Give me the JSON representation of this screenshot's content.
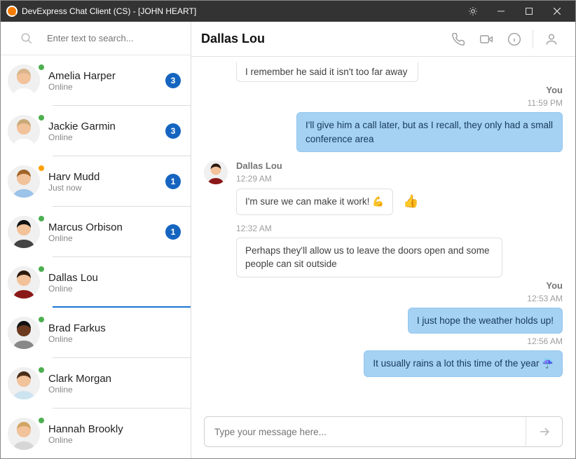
{
  "window": {
    "title": "DevExpress Chat Client (CS) - [JOHN HEART]"
  },
  "search": {
    "placeholder": "Enter text to search..."
  },
  "contacts": [
    {
      "name": "Amelia Harper",
      "sub": "Online",
      "status": "online",
      "badge": "3",
      "hair": "#d9b58a",
      "shirt": "#fff"
    },
    {
      "name": "Jackie Garmin",
      "sub": "Online",
      "status": "online",
      "badge": "3",
      "hair": "#c9a977",
      "shirt": "#fff"
    },
    {
      "name": "Harv Mudd",
      "sub": "Just now",
      "status": "away",
      "badge": "1",
      "hair": "#a0642a",
      "shirt": "#9cc3e8"
    },
    {
      "name": "Marcus Orbison",
      "sub": "Online",
      "status": "online",
      "badge": "1",
      "hair": "#111",
      "shirt": "#444"
    },
    {
      "name": "Dallas Lou",
      "sub": "Online",
      "status": "online",
      "badge": "",
      "selected": true,
      "hair": "#2d1a0e",
      "shirt": "#8a1818"
    },
    {
      "name": "Brad Farkus",
      "sub": "Online",
      "status": "online",
      "badge": "",
      "hair": "#111",
      "shirt": "#888",
      "skin": "#6b3a1f"
    },
    {
      "name": "Clark Morgan",
      "sub": "Online",
      "status": "online",
      "badge": "",
      "hair": "#4b2e17",
      "shirt": "#cce3f0"
    },
    {
      "name": "Hannah Brookly",
      "sub": "Online",
      "status": "online",
      "badge": "",
      "hair": "#d1a563",
      "shirt": "#d6d6d6"
    }
  ],
  "chat": {
    "title": "Dallas Lou",
    "sender_avatar": {
      "hair": "#2d1a0e",
      "shirt": "#8a1818"
    },
    "truncated_top": "I remember he said it isn't too far away",
    "groups": [
      {
        "side": "out",
        "sender": "You",
        "time": "11:59 PM",
        "msgs": [
          "I'll give him a call later, but as I recall, they only had a small conference area"
        ]
      },
      {
        "side": "in",
        "sender": "Dallas Lou",
        "times": [
          "12:29 AM",
          "12:32 AM"
        ],
        "msgs": [
          "I'm sure we can make it work! 💪",
          "Perhaps they'll allow us to leave the doors open and some people can sit outside"
        ],
        "react_first": true
      },
      {
        "side": "out",
        "sender": "You",
        "time": "12:53 AM",
        "msgs": [
          "I just hope the weather holds up!"
        ]
      },
      {
        "side": "out",
        "sender": "",
        "time": "12:56 AM",
        "msgs": [
          "It usually rains a lot this time of the year ☔"
        ]
      }
    ]
  },
  "composer": {
    "placeholder": "Type your message here..."
  }
}
